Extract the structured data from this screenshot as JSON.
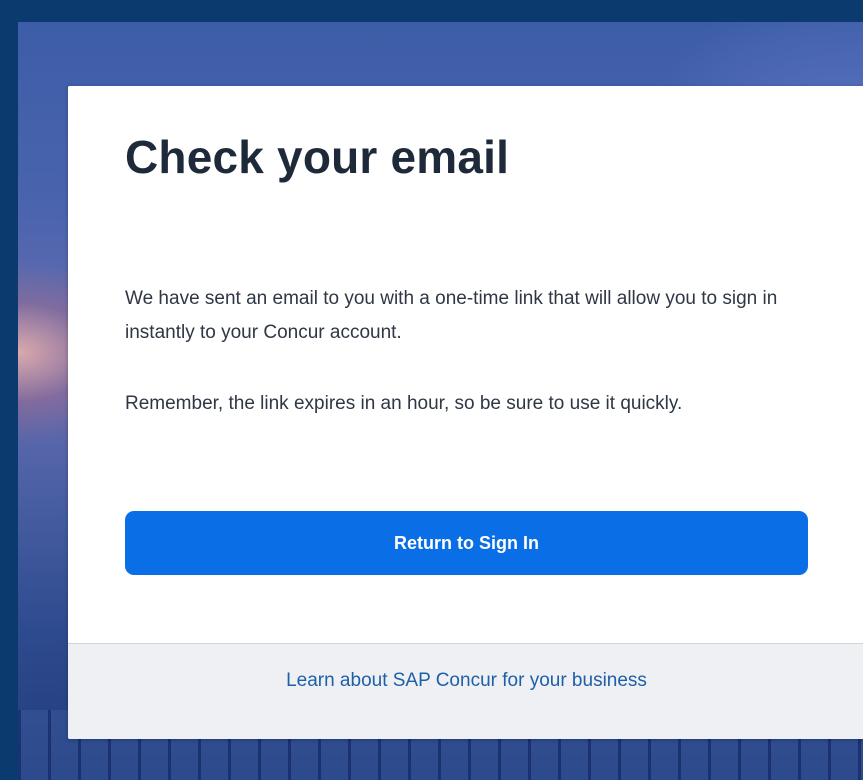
{
  "dialog": {
    "title": "Check your email",
    "paragraph_1": "We have sent an email to you with a one-time link that will allow you to sign in instantly to your Concur account.",
    "paragraph_2": "Remember, the link expires in an hour, so be sure to use it quickly.",
    "return_button_label": "Return to Sign In"
  },
  "footer": {
    "learn_link_label": "Learn about SAP Concur for your business"
  },
  "colors": {
    "primary_button": "#0a6ee6",
    "link": "#1f5fa8",
    "title_text": "#1e2a3a",
    "footer_background": "#eef0f3",
    "page_frame": "#0a3a6e"
  }
}
